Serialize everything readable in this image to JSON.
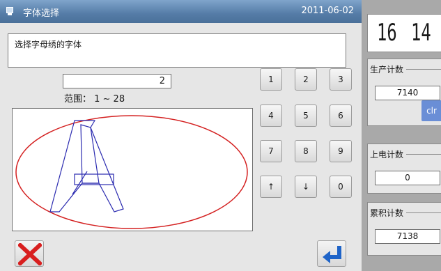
{
  "window": {
    "title": "字体选择",
    "date": "2011-06-02"
  },
  "message": "选择字母绣的字体",
  "font_input": {
    "value": "2",
    "range_label": "范围： 1 ~ 28"
  },
  "keypad": {
    "keys": [
      "1",
      "2",
      "3",
      "4",
      "5",
      "6",
      "7",
      "8",
      "9",
      "↑",
      "↓",
      "0"
    ]
  },
  "preview": {
    "glyph": "A",
    "outline_color": "#2b2bb0",
    "ellipse_color": "#d42020"
  },
  "clock": {
    "hours": "16",
    "minutes": "14"
  },
  "counters": {
    "production": {
      "title": "生产计数",
      "value": "7140",
      "clear_label": "clr"
    },
    "power_on": {
      "title": "上电计数",
      "value": "0"
    },
    "cumulative": {
      "title": "累积计数",
      "value": "7138"
    }
  },
  "icons": {
    "title": "window-icon",
    "cancel": "close-x-icon",
    "enter": "enter-return-icon"
  },
  "colors": {
    "titlebar": "#557ca7",
    "cancel_x": "#d81f1f",
    "enter_arrow": "#1f64c8",
    "clr_button": "#6a8ed6"
  }
}
